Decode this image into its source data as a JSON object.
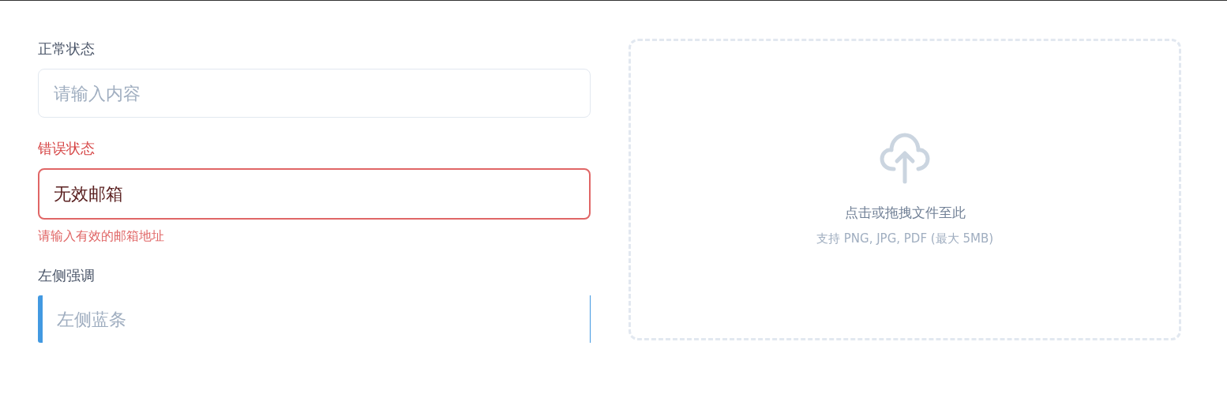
{
  "fields": [
    {
      "kind": "normal",
      "label": "正常状态",
      "placeholder": "请输入内容"
    },
    {
      "kind": "error",
      "label": "错误状态",
      "value": "无效邮箱",
      "error": "请输入有效的邮箱地址"
    },
    {
      "kind": "accent",
      "label": "左侧强调",
      "placeholder": "左侧蓝条"
    }
  ],
  "dropzone": {
    "title": "点击或拖拽文件至此",
    "hint": "支持 PNG, JPG, PDF (最大 5MB)"
  }
}
